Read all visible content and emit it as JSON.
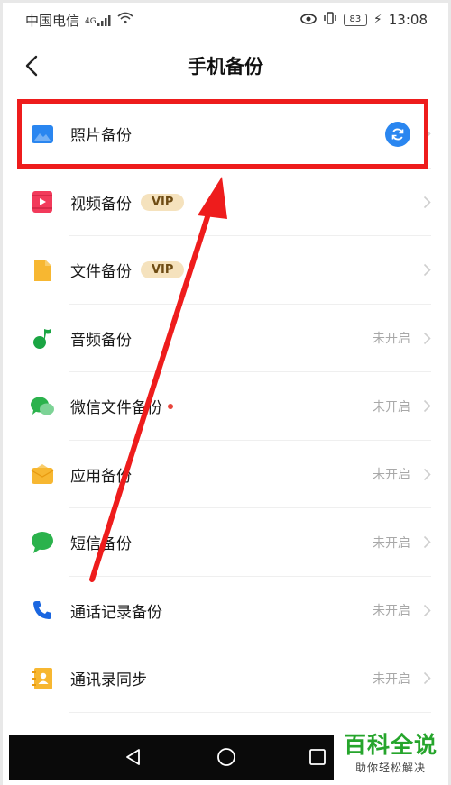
{
  "status_bar": {
    "carrier": "中国电信",
    "network": "4G",
    "battery": "83",
    "time": "13:08"
  },
  "header": {
    "title": "手机备份"
  },
  "items": [
    {
      "label": "照片备份",
      "vip": "",
      "status": "",
      "icon": "photo-icon",
      "icon_color": "#2a86f0"
    },
    {
      "label": "视频备份",
      "vip": "VIP",
      "status": "",
      "icon": "video-icon",
      "icon_color": "#f23a5b"
    },
    {
      "label": "文件备份",
      "vip": "VIP",
      "status": "",
      "icon": "file-icon",
      "icon_color": "#f7b731"
    },
    {
      "label": "音频备份",
      "vip": "",
      "status": "未开启",
      "icon": "music-icon",
      "icon_color": "#1aa543"
    },
    {
      "label": "微信文件备份",
      "vip": "",
      "status": "未开启",
      "icon": "wechat-icon",
      "icon_color": "#2bb24c"
    },
    {
      "label": "应用备份",
      "vip": "",
      "status": "未开启",
      "icon": "app-icon",
      "icon_color": "#f7b731"
    },
    {
      "label": "短信备份",
      "vip": "",
      "status": "未开启",
      "icon": "message-icon",
      "icon_color": "#2bb24c"
    },
    {
      "label": "通话记录备份",
      "vip": "",
      "status": "未开启",
      "icon": "phone-icon",
      "icon_color": "#1a66e0"
    },
    {
      "label": "通讯录同步",
      "vip": "",
      "status": "未开启",
      "icon": "contacts-icon",
      "icon_color": "#f7b731"
    }
  ],
  "watermark": {
    "title": "百科全说",
    "subtitle": "助你轻松解决"
  },
  "colors": {
    "highlight": "#ee1c1c",
    "accent": "#2a86f0"
  }
}
